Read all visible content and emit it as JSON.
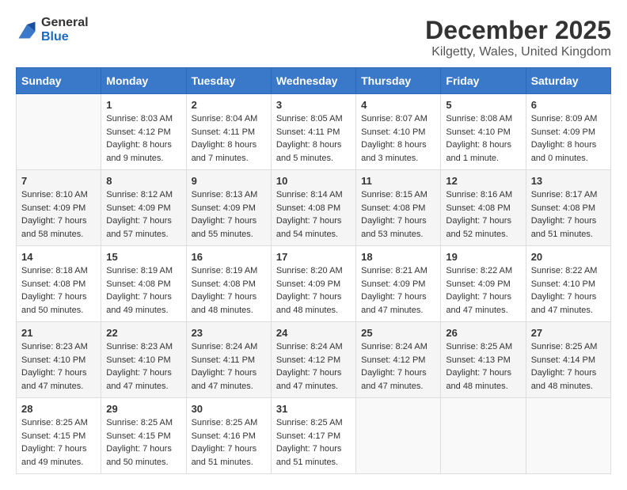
{
  "header": {
    "logo_general": "General",
    "logo_blue": "Blue",
    "month_title": "December 2025",
    "location": "Kilgetty, Wales, United Kingdom"
  },
  "calendar": {
    "days_of_week": [
      "Sunday",
      "Monday",
      "Tuesday",
      "Wednesday",
      "Thursday",
      "Friday",
      "Saturday"
    ],
    "weeks": [
      [
        {
          "day": "",
          "sunrise": "",
          "sunset": "",
          "daylight": "",
          "empty": true
        },
        {
          "day": "1",
          "sunrise": "Sunrise: 8:03 AM",
          "sunset": "Sunset: 4:12 PM",
          "daylight": "Daylight: 8 hours and 9 minutes.",
          "empty": false
        },
        {
          "day": "2",
          "sunrise": "Sunrise: 8:04 AM",
          "sunset": "Sunset: 4:11 PM",
          "daylight": "Daylight: 8 hours and 7 minutes.",
          "empty": false
        },
        {
          "day": "3",
          "sunrise": "Sunrise: 8:05 AM",
          "sunset": "Sunset: 4:11 PM",
          "daylight": "Daylight: 8 hours and 5 minutes.",
          "empty": false
        },
        {
          "day": "4",
          "sunrise": "Sunrise: 8:07 AM",
          "sunset": "Sunset: 4:10 PM",
          "daylight": "Daylight: 8 hours and 3 minutes.",
          "empty": false
        },
        {
          "day": "5",
          "sunrise": "Sunrise: 8:08 AM",
          "sunset": "Sunset: 4:10 PM",
          "daylight": "Daylight: 8 hours and 1 minute.",
          "empty": false
        },
        {
          "day": "6",
          "sunrise": "Sunrise: 8:09 AM",
          "sunset": "Sunset: 4:09 PM",
          "daylight": "Daylight: 8 hours and 0 minutes.",
          "empty": false
        }
      ],
      [
        {
          "day": "7",
          "sunrise": "Sunrise: 8:10 AM",
          "sunset": "Sunset: 4:09 PM",
          "daylight": "Daylight: 7 hours and 58 minutes.",
          "empty": false
        },
        {
          "day": "8",
          "sunrise": "Sunrise: 8:12 AM",
          "sunset": "Sunset: 4:09 PM",
          "daylight": "Daylight: 7 hours and 57 minutes.",
          "empty": false
        },
        {
          "day": "9",
          "sunrise": "Sunrise: 8:13 AM",
          "sunset": "Sunset: 4:09 PM",
          "daylight": "Daylight: 7 hours and 55 minutes.",
          "empty": false
        },
        {
          "day": "10",
          "sunrise": "Sunrise: 8:14 AM",
          "sunset": "Sunset: 4:08 PM",
          "daylight": "Daylight: 7 hours and 54 minutes.",
          "empty": false
        },
        {
          "day": "11",
          "sunrise": "Sunrise: 8:15 AM",
          "sunset": "Sunset: 4:08 PM",
          "daylight": "Daylight: 7 hours and 53 minutes.",
          "empty": false
        },
        {
          "day": "12",
          "sunrise": "Sunrise: 8:16 AM",
          "sunset": "Sunset: 4:08 PM",
          "daylight": "Daylight: 7 hours and 52 minutes.",
          "empty": false
        },
        {
          "day": "13",
          "sunrise": "Sunrise: 8:17 AM",
          "sunset": "Sunset: 4:08 PM",
          "daylight": "Daylight: 7 hours and 51 minutes.",
          "empty": false
        }
      ],
      [
        {
          "day": "14",
          "sunrise": "Sunrise: 8:18 AM",
          "sunset": "Sunset: 4:08 PM",
          "daylight": "Daylight: 7 hours and 50 minutes.",
          "empty": false
        },
        {
          "day": "15",
          "sunrise": "Sunrise: 8:19 AM",
          "sunset": "Sunset: 4:08 PM",
          "daylight": "Daylight: 7 hours and 49 minutes.",
          "empty": false
        },
        {
          "day": "16",
          "sunrise": "Sunrise: 8:19 AM",
          "sunset": "Sunset: 4:08 PM",
          "daylight": "Daylight: 7 hours and 48 minutes.",
          "empty": false
        },
        {
          "day": "17",
          "sunrise": "Sunrise: 8:20 AM",
          "sunset": "Sunset: 4:09 PM",
          "daylight": "Daylight: 7 hours and 48 minutes.",
          "empty": false
        },
        {
          "day": "18",
          "sunrise": "Sunrise: 8:21 AM",
          "sunset": "Sunset: 4:09 PM",
          "daylight": "Daylight: 7 hours and 47 minutes.",
          "empty": false
        },
        {
          "day": "19",
          "sunrise": "Sunrise: 8:22 AM",
          "sunset": "Sunset: 4:09 PM",
          "daylight": "Daylight: 7 hours and 47 minutes.",
          "empty": false
        },
        {
          "day": "20",
          "sunrise": "Sunrise: 8:22 AM",
          "sunset": "Sunset: 4:10 PM",
          "daylight": "Daylight: 7 hours and 47 minutes.",
          "empty": false
        }
      ],
      [
        {
          "day": "21",
          "sunrise": "Sunrise: 8:23 AM",
          "sunset": "Sunset: 4:10 PM",
          "daylight": "Daylight: 7 hours and 47 minutes.",
          "empty": false
        },
        {
          "day": "22",
          "sunrise": "Sunrise: 8:23 AM",
          "sunset": "Sunset: 4:10 PM",
          "daylight": "Daylight: 7 hours and 47 minutes.",
          "empty": false
        },
        {
          "day": "23",
          "sunrise": "Sunrise: 8:24 AM",
          "sunset": "Sunset: 4:11 PM",
          "daylight": "Daylight: 7 hours and 47 minutes.",
          "empty": false
        },
        {
          "day": "24",
          "sunrise": "Sunrise: 8:24 AM",
          "sunset": "Sunset: 4:12 PM",
          "daylight": "Daylight: 7 hours and 47 minutes.",
          "empty": false
        },
        {
          "day": "25",
          "sunrise": "Sunrise: 8:24 AM",
          "sunset": "Sunset: 4:12 PM",
          "daylight": "Daylight: 7 hours and 47 minutes.",
          "empty": false
        },
        {
          "day": "26",
          "sunrise": "Sunrise: 8:25 AM",
          "sunset": "Sunset: 4:13 PM",
          "daylight": "Daylight: 7 hours and 48 minutes.",
          "empty": false
        },
        {
          "day": "27",
          "sunrise": "Sunrise: 8:25 AM",
          "sunset": "Sunset: 4:14 PM",
          "daylight": "Daylight: 7 hours and 48 minutes.",
          "empty": false
        }
      ],
      [
        {
          "day": "28",
          "sunrise": "Sunrise: 8:25 AM",
          "sunset": "Sunset: 4:15 PM",
          "daylight": "Daylight: 7 hours and 49 minutes.",
          "empty": false
        },
        {
          "day": "29",
          "sunrise": "Sunrise: 8:25 AM",
          "sunset": "Sunset: 4:15 PM",
          "daylight": "Daylight: 7 hours and 50 minutes.",
          "empty": false
        },
        {
          "day": "30",
          "sunrise": "Sunrise: 8:25 AM",
          "sunset": "Sunset: 4:16 PM",
          "daylight": "Daylight: 7 hours and 51 minutes.",
          "empty": false
        },
        {
          "day": "31",
          "sunrise": "Sunrise: 8:25 AM",
          "sunset": "Sunset: 4:17 PM",
          "daylight": "Daylight: 7 hours and 51 minutes.",
          "empty": false
        },
        {
          "day": "",
          "sunrise": "",
          "sunset": "",
          "daylight": "",
          "empty": true
        },
        {
          "day": "",
          "sunrise": "",
          "sunset": "",
          "daylight": "",
          "empty": true
        },
        {
          "day": "",
          "sunrise": "",
          "sunset": "",
          "daylight": "",
          "empty": true
        }
      ]
    ]
  }
}
